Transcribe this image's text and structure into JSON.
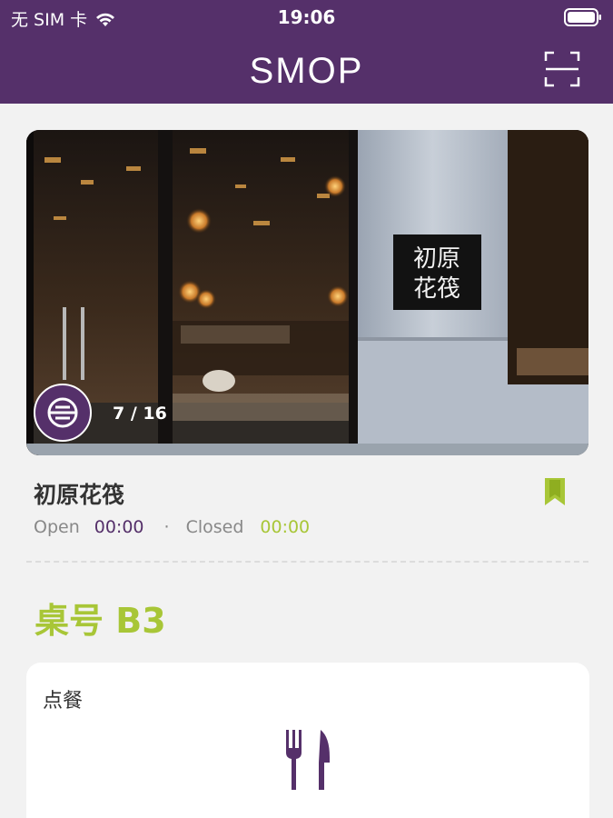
{
  "status_bar": {
    "carrier": "无 SIM 卡",
    "time": "19:06"
  },
  "navbar": {
    "logo_text": "SMOP",
    "scan_icon": "scan-icon"
  },
  "hero": {
    "pager_text": "7 / 16",
    "sign_text": "初原花筏",
    "pager_icon": "subway-icon"
  },
  "restaurant": {
    "name": "初原花筏",
    "bookmark_icon": "bookmark-icon",
    "open_label": "Open",
    "open_time": "00:00",
    "separator": "·",
    "closed_label": "Closed",
    "closed_time": "00:00"
  },
  "table": {
    "label": "桌号 B3"
  },
  "order_card": {
    "title": "点餐",
    "icon": "cutlery-icon"
  },
  "colors": {
    "brand_purple": "#55306a",
    "accent_green": "#a8c637",
    "background": "#f2f2f2"
  }
}
